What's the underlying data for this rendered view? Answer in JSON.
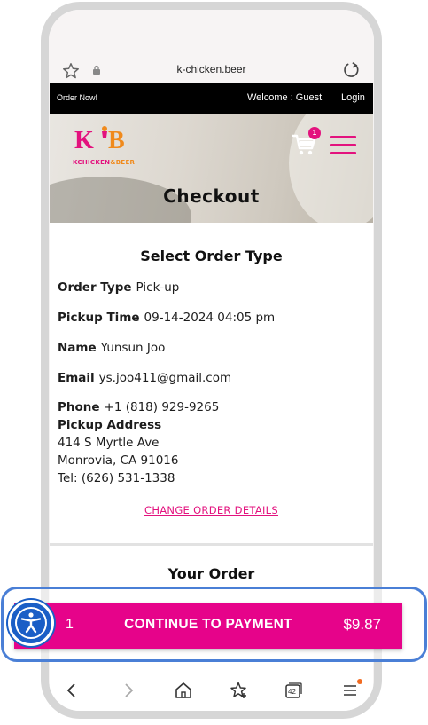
{
  "browser": {
    "url": "k-chicken.beer"
  },
  "topbar": {
    "order_now": "Order Now!",
    "welcome": "Welcome : Guest",
    "separator": "|",
    "login": "Login"
  },
  "hero": {
    "logo_main": "K",
    "logo_b": "B",
    "logo_sub_1": "K",
    "logo_sub_chicken": "CHICKEN",
    "logo_sub_and": "&",
    "logo_sub_beer": "BEER",
    "cart_count": "1",
    "title": "Checkout"
  },
  "order_type": {
    "heading": "Select Order Type",
    "order_type_label": "Order Type",
    "order_type_value": "Pick-up",
    "pickup_time_label": "Pickup Time",
    "pickup_time_value": "09-14-2024 04:05 pm",
    "name_label": "Name",
    "name_value": "Yunsun Joo",
    "email_label": "Email",
    "email_value": "ys.joo411@gmail.com",
    "phone_label": "Phone",
    "phone_value": "+1 (818) 929-9265",
    "pickup_address_label": "Pickup Address",
    "address_line1": "414 S Myrtle Ave",
    "address_line2": "Monrovia, CA 91016",
    "address_tel": "Tel: (626) 531-1338",
    "change_link": "CHANGE ORDER DETAILS"
  },
  "your_order": {
    "heading": "Your Order"
  },
  "payment_bar": {
    "quantity": "1",
    "label": "CONTINUE TO PAYMENT",
    "price": "$9.87"
  },
  "nav": {
    "tab_count": "42"
  },
  "colors": {
    "brand_pink": "#e6038a",
    "brand_orange": "#f08a1c",
    "focus_blue": "#4a7fd6",
    "a11y_blue": "#1a5ec6"
  }
}
